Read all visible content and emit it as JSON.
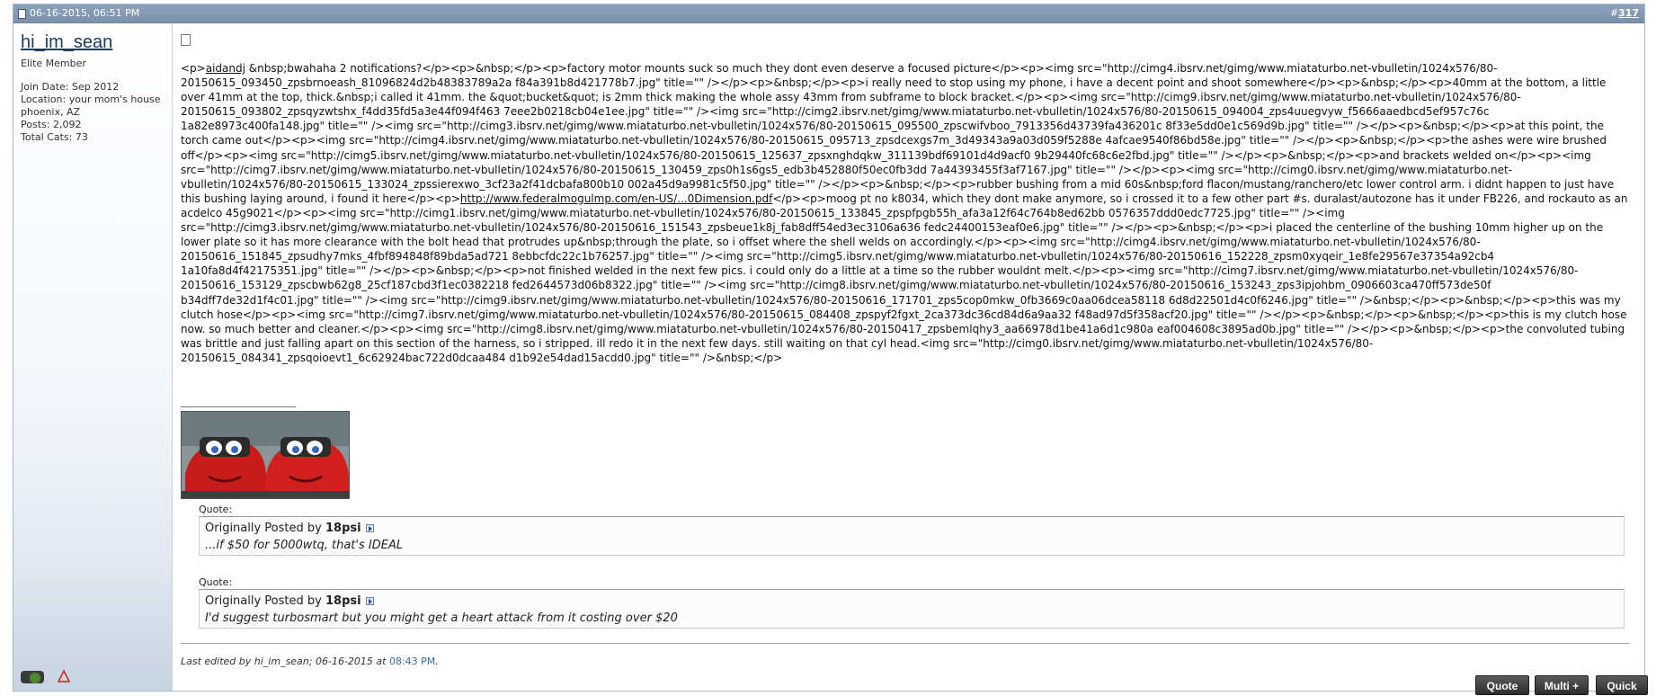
{
  "post_header": {
    "date": "06-16-2015, 06:51 PM",
    "post_prefix": "#",
    "post_number": "317"
  },
  "user": {
    "name": "hi_im_sean",
    "title": "Elite Member",
    "join_date": "Join Date: Sep 2012",
    "location": "Location: your mom's house phoenix, AZ",
    "posts": "Posts: 2,092",
    "total_cats": "Total Cats: 73"
  },
  "message": {
    "p1_prefix": "<p>",
    "mention": "aidandj",
    "p1_rest": " &nbsp;bwahaha 2 notifications?</p><p>&nbsp;</p><p>factory motor mounts suck so much they dont even deserve a focused picture</p><p><img src=\"http://cimg4.ibsrv.net/gimg/www.miataturbo.net-vbulletin/1024x576/80-20150615_093450_zpsbrnoeash_81096824d2b48383789a2a f84a391b8d421778b7.jpg\" title=\"\" /></p><p>&nbsp;</p><p>i really need to stop using my phone, i have a decent point and shoot somewhere</p><p>&nbsp;</p><p>40mm at the bottom, a little over 41mm at the top, thick.&nbsp;i called it 41mm. the &quot;bucket&quot; is 2mm thick making the whole assy 43mm from subframe to block bracket.</p><p><img src=\"http://cimg9.ibsrv.net/gimg/www.miataturbo.net-vbulletin/1024x576/80-20150615_093802_zpsqyzwtshx_f4dd35fd5a3e44f094f463 7eee2b0218cb04e1ee.jpg\" title=\"\" /><img src=\"http://cimg2.ibsrv.net/gimg/www.miataturbo.net-vbulletin/1024x576/80-20150615_094004_zps4uuegvyw_f5666aaedbcd5ef957c76c 1a82e8973c400fa148.jpg\" title=\"\" /><img src=\"http://cimg3.ibsrv.net/gimg/www.miataturbo.net-vbulletin/1024x576/80-20150615_095500_zpscwifvboo_7913356d43739fa436201c 8f33e5dd0e1c569d9b.jpg\" title=\"\" /></p><p>&nbsp;</p><p>at this point, the torch came out</p><p><img src=\"http://cimg4.ibsrv.net/gimg/www.miataturbo.net-vbulletin/1024x576/80-20150615_095713_zpsdcexgs7m_3d49343a9a03d059f5288e 4afcae9540f86bd58e.jpg\" title=\"\" /></p><p>&nbsp;</p><p>the ashes were wire brushed off</p><p><img src=\"http://cimg5.ibsrv.net/gimg/www.miataturbo.net-vbulletin/1024x576/80-20150615_125637_zpsxnghdqkw_311139bdf69101d4d9acf0 9b29440fc68c6e2fbd.jpg\" title=\"\" /></p><p>&nbsp;</p><p>and brackets welded on</p><p><img src=\"http://cimg7.ibsrv.net/gimg/www.miataturbo.net-vbulletin/1024x576/80-20150615_130459_zps0h1s6gs5_edb3b452880f50ec0fb3dd 7a44393455f3af7167.jpg\" title=\"\" /></p><p><img src=\"http://cimg0.ibsrv.net/gimg/www.miataturbo.net-vbulletin/1024x576/80-20150615_133024_zpssierexwo_3cf23a2f41dcbafa800b10 002a45d9a9981c5f50.jpg\" title=\"\" /></p><p>&nbsp;</p><p>rubber bushing from a mid 60s&nbsp;ford flacon/mustang/ranchero/etc lower control arm. i didnt happen to just have this bushing laying around, i found it here</p><p>",
    "link": "http://www.federalmogulmp.com/en-US/...0Dimension.pdf",
    "p1_tail": "</p><p>moog pt no k8034, which they dont make anymore, so i crossed it to a few other part #s. duralast/autozone has it under FB226, and rockauto as an acdelco 45g9021</p><p><img src=\"http://cimg1.ibsrv.net/gimg/www.miataturbo.net-vbulletin/1024x576/80-20150615_133845_zpspfpgb55h_afa3a12f64c764b8ed62bb 0576357ddd0edc7725.jpg\" title=\"\" /><img src=\"http://cimg3.ibsrv.net/gimg/www.miataturbo.net-vbulletin/1024x576/80-20150616_151543_zpsbeue1k8j_fab8dff54ed3ec3106a636 fedc24400153eaf0e6.jpg\" title=\"\" /></p><p>&nbsp;</p><p>i placed the centerline of the bushing 10mm higher up on the lower plate so it has more clearance with the bolt head that protrudes up&nbsp;through the plate, so i offset where the shell welds on accordingly.</p><p><img src=\"http://cimg4.ibsrv.net/gimg/www.miataturbo.net-vbulletin/1024x576/80-20150616_151845_zpsudhy7mks_4fbf894848f89bda5ad721 8ebbcfdc22c1b76257.jpg\" title=\"\" /><img src=\"http://cimg5.ibsrv.net/gimg/www.miataturbo.net-vbulletin/1024x576/80-20150616_152228_zpsm0xyqeir_1e8fe29567e37354a92cb4 1a10fa8d4f42175351.jpg\" title=\"\" /></p><p>&nbsp;</p><p>not finished welded in the next few pics. i could only do a little at a time so the rubber wouldnt melt.</p><p><img src=\"http://cimg7.ibsrv.net/gimg/www.miataturbo.net-vbulletin/1024x576/80-20150616_153129_zpscbwb62g8_25cf187cbd3f1ec0382218 fed2644573d06b8322.jpg\" title=\"\" /><img src=\"http://cimg8.ibsrv.net/gimg/www.miataturbo.net-vbulletin/1024x576/80-20150616_153243_zps3ipjohbm_0906603ca470ff573de50f b34dff7de32d1f4c01.jpg\" title=\"\" /><img src=\"http://cimg9.ibsrv.net/gimg/www.miataturbo.net-vbulletin/1024x576/80-20150616_171701_zps5cop0mkw_0fb3669c0aa06dcea58118 6d8d22501d4c0f6246.jpg\" title=\"\" />&nbsp;</p><p>&nbsp;</p><p>this was my clutch hose</p><p><img src=\"http://cimg7.ibsrv.net/gimg/www.miataturbo.net-vbulletin/1024x576/80-20150615_084408_zpspyf2fgxt_2ca373dc36cd84d6a9aa32 f48ad97d5f358acf20.jpg\" title=\"\" /></p><p>&nbsp;</p><p>&nbsp;</p><p>this is my clutch hose now. so much better and cleaner.</p><p><img src=\"http://cimg8.ibsrv.net/gimg/www.miataturbo.net-vbulletin/1024x576/80-20150417_zpsbemlqhy3_aa66978d1be41a6d1c980a eaf004608c3895ad0b.jpg\" title=\"\" /></p><p>&nbsp;</p><p>the convoluted tubing was brittle and just falling apart on this section of the harness, so i stripped. ill redo it in the next few days. still waiting on that cyl head.<img src=\"http://cimg0.ibsrv.net/gimg/www.miataturbo.net-vbulletin/1024x576/80-20150615_084341_zpsqoioevt1_6c62924bac722d0dcaa484 d1b92e54dad15acdd0.jpg\" title=\"\" />&nbsp;</p>"
  },
  "quotes": [
    {
      "label": "Quote:",
      "originally_posted_by": "Originally Posted by",
      "author": "18psi",
      "text": "...if $50 for 5000wtq, that's IDEAL"
    },
    {
      "label": "Quote:",
      "originally_posted_by": "Originally Posted by",
      "author": "18psi",
      "text": "I'd suggest turbosmart but you might get a heart attack from it costing over $20"
    }
  ],
  "edit_info": {
    "prefix": "Last edited by hi_im_sean; 06-16-2015 at ",
    "time": "08:43 PM",
    "suffix": "."
  },
  "buttons": {
    "quote": "Quote",
    "multi": "Multi +",
    "quick": "Quick"
  }
}
